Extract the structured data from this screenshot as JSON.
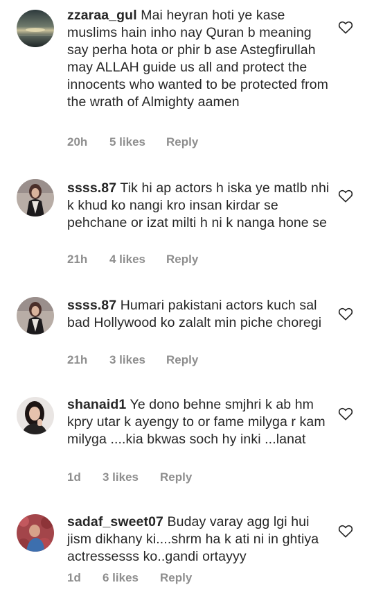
{
  "comments": [
    {
      "username": "zzaraa_gul",
      "text": "Mai heyran hoti ye kase muslims hain inho nay Quran b meaning say perha hota or phir b ase Astegfirullah may ALLAH guide us all and protect the innocents who wanted to be protected from the wrath of Almighty aamen",
      "time": "20h",
      "likes": "5 likes",
      "reply": "Reply",
      "avatar_icon": "sunset-sea-avatar"
    },
    {
      "username": "ssss.87",
      "text": "Tik hi ap actors h iska ye matlb nhi k khud ko nangi kro insan kirdar se pehchane or izat milti h ni k nanga hone se",
      "time": "21h",
      "likes": "4 likes",
      "reply": "Reply",
      "avatar_icon": "woman-portrait-avatar"
    },
    {
      "username": "ssss.87",
      "text": "Humari pakistani actors kuch sal bad Hollywood ko zalalt min piche choregi",
      "time": "21h",
      "likes": "3 likes",
      "reply": "Reply",
      "avatar_icon": "woman-portrait-avatar"
    },
    {
      "username": "shanaid1",
      "text": "Ye dono behne smjhri k ab hm kpry utar k ayengy to or fame milyga r kam milyga ....kia bkwas soch hy inki ...lanat",
      "time": "1d",
      "likes": "3 likes",
      "reply": "Reply",
      "avatar_icon": "girl-portrait-avatar"
    },
    {
      "username": "sadaf_sweet07",
      "text": "Buday varay agg lgi hui jism dikhany ki....shrm ha k ati ni in ghtiya actressesss ko..gandi ortayyy",
      "time": "1d",
      "likes": "6 likes",
      "reply": "Reply",
      "avatar_icon": "child-flowers-avatar"
    }
  ]
}
